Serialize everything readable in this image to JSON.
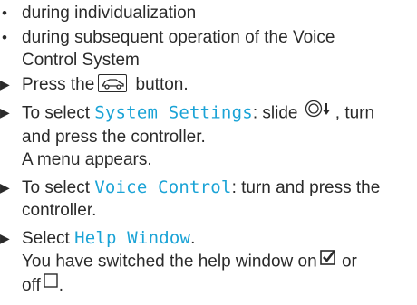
{
  "bullets": [
    {
      "text": "during individualization"
    },
    {
      "line1": "during subsequent operation of the Voice",
      "line2": "Control System"
    }
  ],
  "steps": {
    "step1": {
      "pre": "Press the",
      "post": " button.",
      "button_icon": "car-icon"
    },
    "step2": {
      "pre": "To select ",
      "mono": "System Settings",
      "mid": ": slide ",
      "controller_icon": "controller-slide-down-icon",
      "post": ", turn",
      "line2": "and press the controller.",
      "line3": "A menu appears."
    },
    "step3": {
      "pre": "To select ",
      "mono": "Voice Control",
      "post": ": turn and press the",
      "line2": "controller."
    },
    "step4": {
      "pre": "Select ",
      "mono": "Help Window",
      "post": ".",
      "line2_pre": "You have switched the help window on",
      "line2_post": " or",
      "line3_pre": "off",
      "line3_post": ".",
      "checked_icon": "checkbox-checked-icon",
      "unchecked_icon": "checkbox-empty-icon"
    }
  },
  "colors": {
    "text": "#2a2a2a",
    "highlight": "#1aa3d6"
  }
}
